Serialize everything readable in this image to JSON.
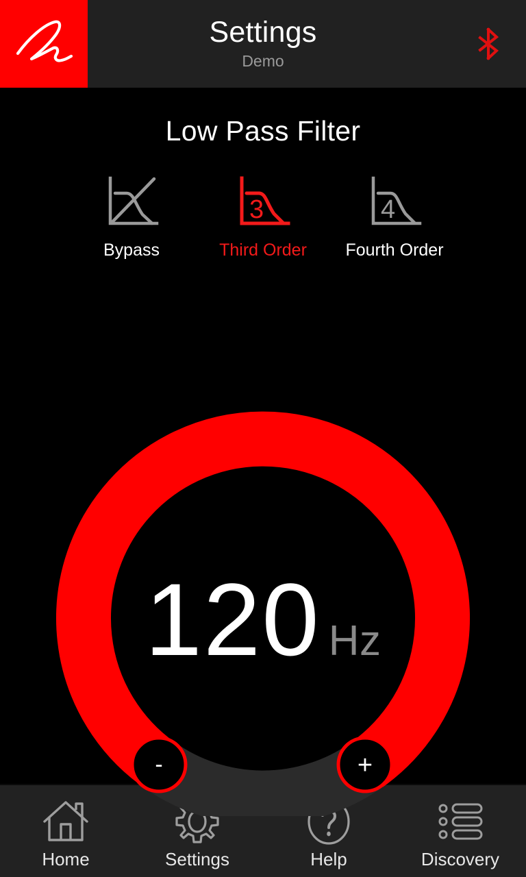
{
  "header": {
    "logo_icon": "brand-signature-logo",
    "logo_bg": "#FF0000",
    "title": "Settings",
    "subtitle": "Demo",
    "bluetooth_icon": "bluetooth-icon",
    "bluetooth_color": "#E01010",
    "background": "#212121"
  },
  "main": {
    "section_title": "Low Pass Filter",
    "filter_orders": [
      {
        "id": "bypass",
        "label": "Bypass",
        "icon": "filter-bypass-icon",
        "selected": false,
        "color": "#9a9a9a"
      },
      {
        "id": "third-order",
        "label": "Third Order",
        "icon": "filter-third-order-icon",
        "digit": "3",
        "selected": true,
        "color": "#F31A1A"
      },
      {
        "id": "fourth-order",
        "label": "Fourth Order",
        "icon": "filter-fourth-order-icon",
        "digit": "4",
        "selected": false,
        "color": "#9a9a9a"
      }
    ],
    "dial": {
      "value": "120",
      "unit": "Hz",
      "arc_color": "#FF0000",
      "track_color": "#2B2B2B",
      "decrement_label": "-",
      "increment_label": "+",
      "decrement_name": "decrease-frequency-button",
      "increment_name": "increase-frequency-button"
    }
  },
  "navbar": {
    "background": "#222222",
    "items": [
      {
        "id": "home",
        "label": "Home",
        "icon": "home-icon"
      },
      {
        "id": "settings",
        "label": "Settings",
        "icon": "gear-icon"
      },
      {
        "id": "help",
        "label": "Help",
        "icon": "question-mark-circle-icon"
      },
      {
        "id": "discovery",
        "label": "Discovery",
        "icon": "list-icon"
      }
    ]
  }
}
